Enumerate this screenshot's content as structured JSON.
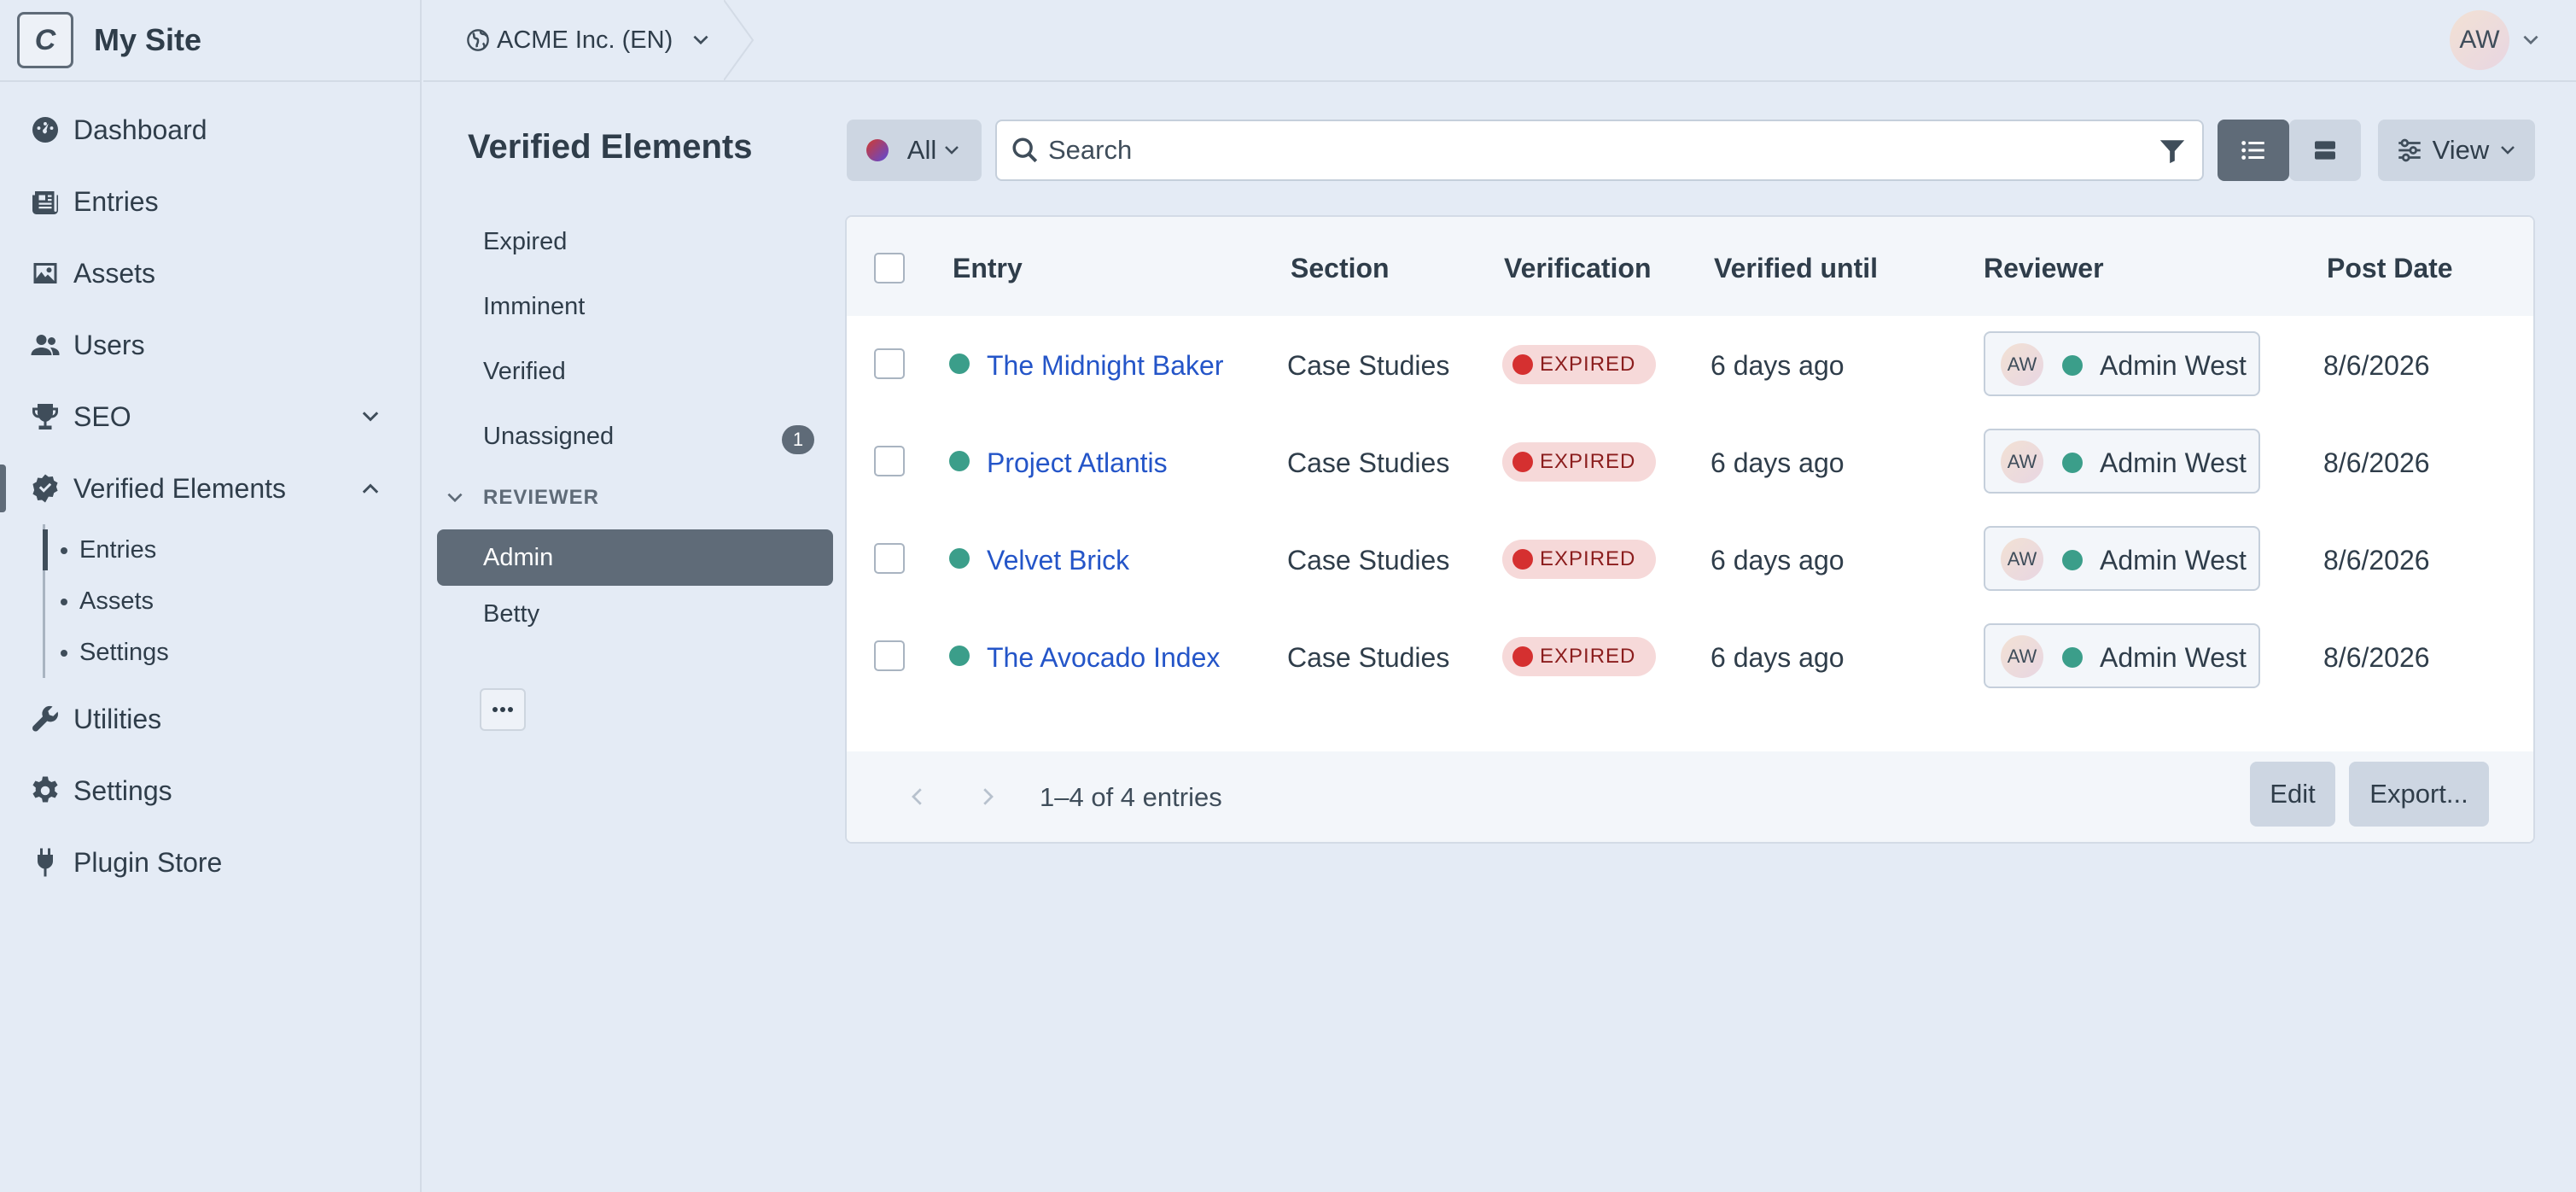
{
  "site": {
    "logo_letter": "C",
    "name": "My Site"
  },
  "nav": {
    "items": [
      {
        "label": "Dashboard",
        "icon": "gauge-icon"
      },
      {
        "label": "Entries",
        "icon": "newspaper-icon"
      },
      {
        "label": "Assets",
        "icon": "image-icon"
      },
      {
        "label": "Users",
        "icon": "users-icon"
      },
      {
        "label": "SEO",
        "icon": "trophy-icon"
      },
      {
        "label": "Verified Elements",
        "icon": "check-badge-icon"
      },
      {
        "label": "Utilities",
        "icon": "wrench-icon"
      },
      {
        "label": "Settings",
        "icon": "gear-icon"
      },
      {
        "label": "Plugin Store",
        "icon": "plug-icon"
      }
    ],
    "sub_items": [
      "Entries",
      "Assets",
      "Settings"
    ]
  },
  "topbar": {
    "site_switcher": "ACME Inc. (EN)",
    "user_initials": "AW"
  },
  "page": {
    "title": "Verified Elements"
  },
  "sources": {
    "items": [
      {
        "label": "Expired"
      },
      {
        "label": "Imminent"
      },
      {
        "label": "Verified"
      },
      {
        "label": "Unassigned",
        "badge": "1"
      }
    ],
    "heading": "REVIEWER",
    "reviewers": [
      "Admin",
      "Betty"
    ]
  },
  "toolbar": {
    "status_label": "All",
    "search_placeholder": "Search",
    "view_label": "View"
  },
  "table": {
    "columns": [
      "Entry",
      "Section",
      "Verification",
      "Verified until",
      "Reviewer",
      "Post Date"
    ],
    "rows": [
      {
        "entry": "The Midnight Baker",
        "section": "Case Studies",
        "verification": "EXPIRED",
        "verified_until": "6 days ago",
        "reviewer_initials": "AW",
        "reviewer": "Admin West",
        "post_date": "8/6/2026"
      },
      {
        "entry": "Project Atlantis",
        "section": "Case Studies",
        "verification": "EXPIRED",
        "verified_until": "6 days ago",
        "reviewer_initials": "AW",
        "reviewer": "Admin West",
        "post_date": "8/6/2026"
      },
      {
        "entry": "Velvet Brick",
        "section": "Case Studies",
        "verification": "EXPIRED",
        "verified_until": "6 days ago",
        "reviewer_initials": "AW",
        "reviewer": "Admin West",
        "post_date": "8/6/2026"
      },
      {
        "entry": "The Avocado Index",
        "section": "Case Studies",
        "verification": "EXPIRED",
        "verified_until": "6 days ago",
        "reviewer_initials": "AW",
        "reviewer": "Admin West",
        "post_date": "8/6/2026"
      }
    ],
    "footer": {
      "count": "1–4 of 4 entries",
      "edit_label": "Edit",
      "export_label": "Export..."
    }
  },
  "colors": {
    "link": "#2455c8",
    "status_enabled": "#3b9e8a",
    "expired": "#d53030",
    "selected_bg": "#5f6b78"
  }
}
